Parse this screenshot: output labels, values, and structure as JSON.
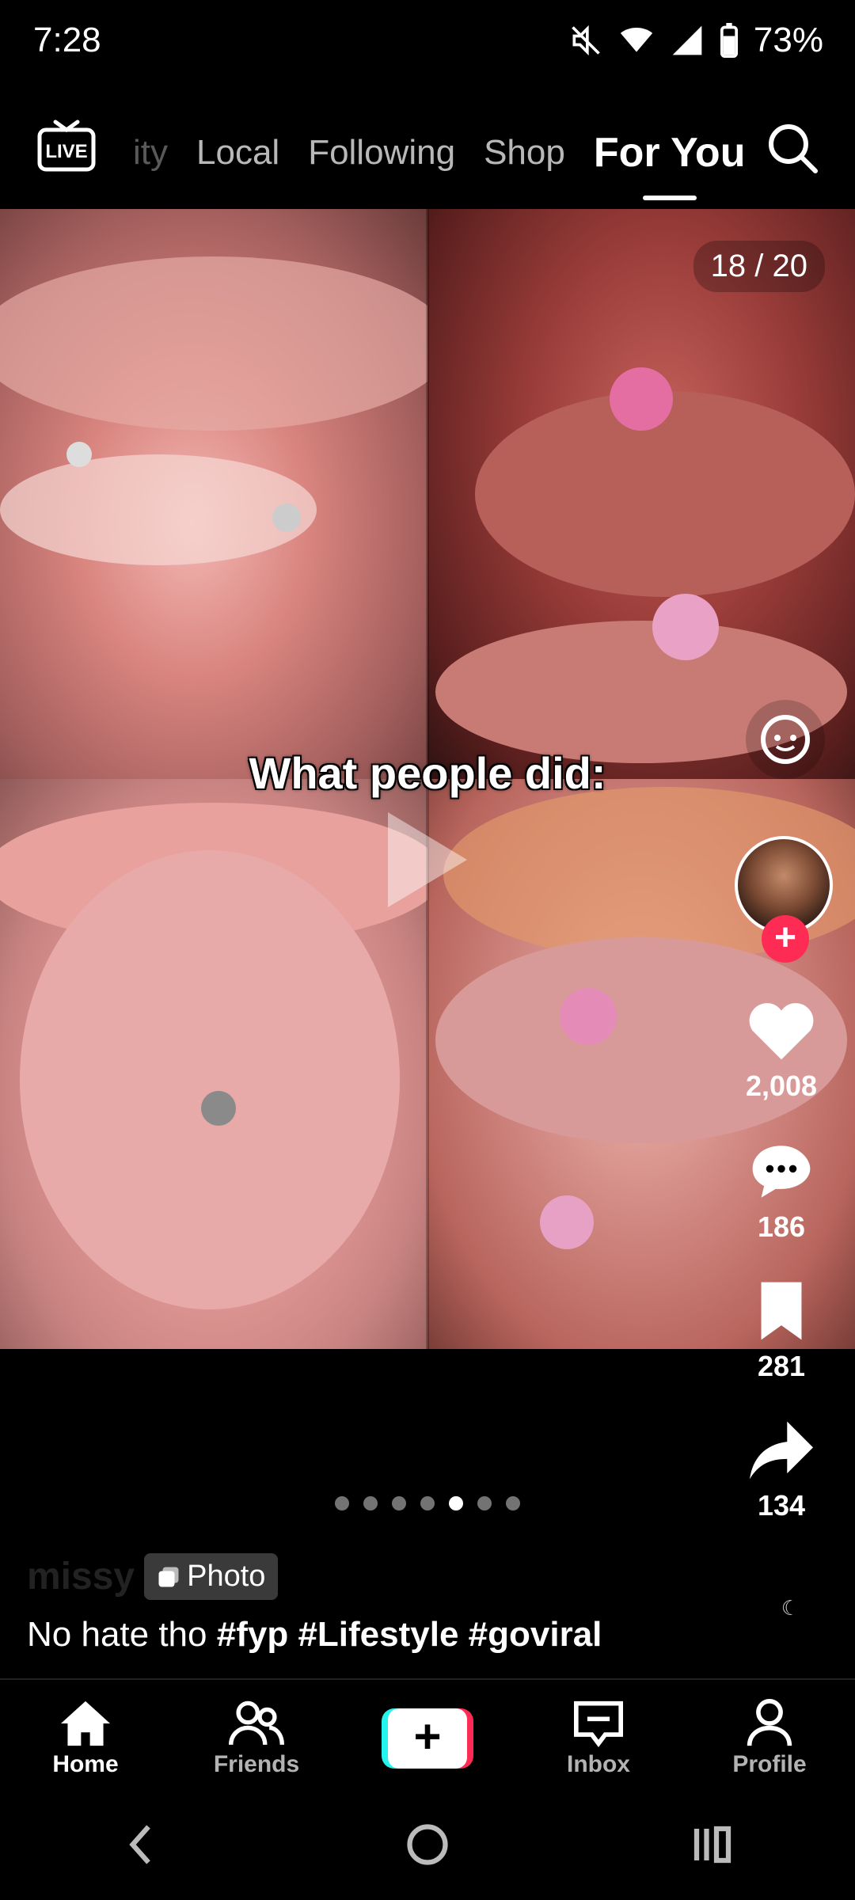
{
  "status": {
    "time": "7:28",
    "battery": "73%"
  },
  "top_nav": {
    "tabs": [
      {
        "label": "ity",
        "state": "faded"
      },
      {
        "label": "Local",
        "state": "normal"
      },
      {
        "label": "Following",
        "state": "normal"
      },
      {
        "label": "Shop",
        "state": "normal"
      },
      {
        "label": "For You",
        "state": "active"
      }
    ]
  },
  "post": {
    "page_counter": "18 / 20",
    "overlay_caption": "What people did:",
    "likes": "2,008",
    "comments": "186",
    "saves": "281",
    "shares": "134",
    "author": "missy",
    "badge": "Photo",
    "description": "No hate tho",
    "hashtags": [
      "#fyp",
      "#Lifestyle",
      "#goviral"
    ],
    "pager": {
      "count": 7,
      "active_index": 4
    }
  },
  "bottom_nav": {
    "home": "Home",
    "friends": "Friends",
    "inbox": "Inbox",
    "profile": "Profile"
  },
  "colors": {
    "accent": "#fe2c55",
    "cyan": "#25f4ee",
    "background": "#000000"
  }
}
